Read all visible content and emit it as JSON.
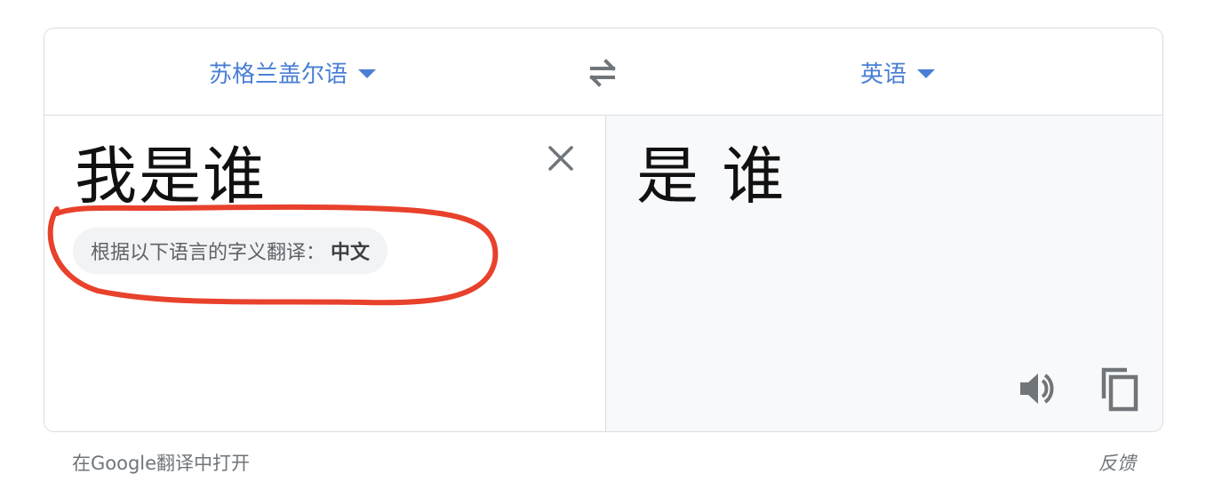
{
  "language_bar": {
    "source_language": "苏格兰盖尔语",
    "target_language": "英语"
  },
  "source": {
    "text": "我是谁",
    "detected_prefix": "根据以下语言的字义翻译：",
    "detected_language": "中文"
  },
  "target": {
    "text": "是 谁"
  },
  "footer": {
    "open_link": "在Google翻译中打开",
    "feedback": "反馈"
  },
  "colors": {
    "accent": "#4a7fd4",
    "annotation": "#e8412c",
    "icon": "#70757a"
  },
  "icons": {
    "dropdown": "caret-down-icon",
    "swap": "swap-arrows-icon",
    "clear": "close-icon",
    "speak": "speaker-icon",
    "copy": "copy-icon"
  }
}
